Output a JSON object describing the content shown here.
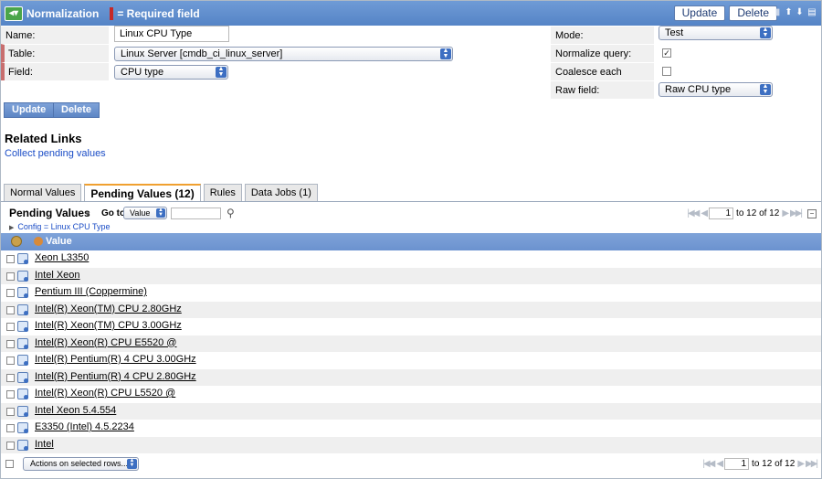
{
  "header": {
    "title": "Normalization",
    "required_legend": "= Required field",
    "update_label": "Update",
    "delete_label": "Delete"
  },
  "form": {
    "name_label": "Name:",
    "name_value": "Linux CPU Type",
    "table_label": "Table:",
    "table_value": "Linux Server [cmdb_ci_linux_server]",
    "field_label": "Field:",
    "field_value": "CPU type",
    "mode_label": "Mode:",
    "mode_value": "Test",
    "normalize_label": "Normalize query:",
    "normalize_checked": true,
    "coalesce_label": "Coalesce each normal:",
    "coalesce_checked": false,
    "raw_label": "Raw field:",
    "raw_value": "Raw CPU type"
  },
  "buttons": {
    "update": "Update",
    "delete": "Delete"
  },
  "related": {
    "title": "Related Links",
    "link": "Collect pending values"
  },
  "tabs": [
    {
      "label": "Normal Values",
      "active": false
    },
    {
      "label": "Pending Values (12)",
      "active": true
    },
    {
      "label": "Rules",
      "active": false
    },
    {
      "label": "Data Jobs (1)",
      "active": false
    }
  ],
  "list": {
    "title": "Pending Values",
    "goto_label": "Go to",
    "goto_value": "Value",
    "breadcrumb": "Config = Linux CPU Type",
    "column": "Value",
    "pager_page": "1",
    "pager_text": "to 12 of 12",
    "rows": [
      "Xeon L3350",
      "Intel Xeon",
      "Pentium III (Coppermine)",
      "Intel(R) Xeon(TM) CPU 2.80GHz",
      "Intel(R) Xeon(TM) CPU 3.00GHz",
      "Intel(R) Xeon(R) CPU E5520 @",
      "Intel(R) Pentium(R) 4 CPU 3.00GHz",
      "Intel(R) Pentium(R) 4 CPU 2.80GHz",
      "Intel(R) Xeon(R) CPU L5520 @",
      "Intel Xeon 5.4.554",
      "E3350 (Intel) 4.5.2234",
      "Intel"
    ],
    "actions_label": "Actions on selected rows..."
  },
  "colors": {
    "header_blue": "#5f8dcc",
    "required_red": "#c62828",
    "tab_accent": "#f0a030",
    "link_blue": "#1a4cc6"
  }
}
